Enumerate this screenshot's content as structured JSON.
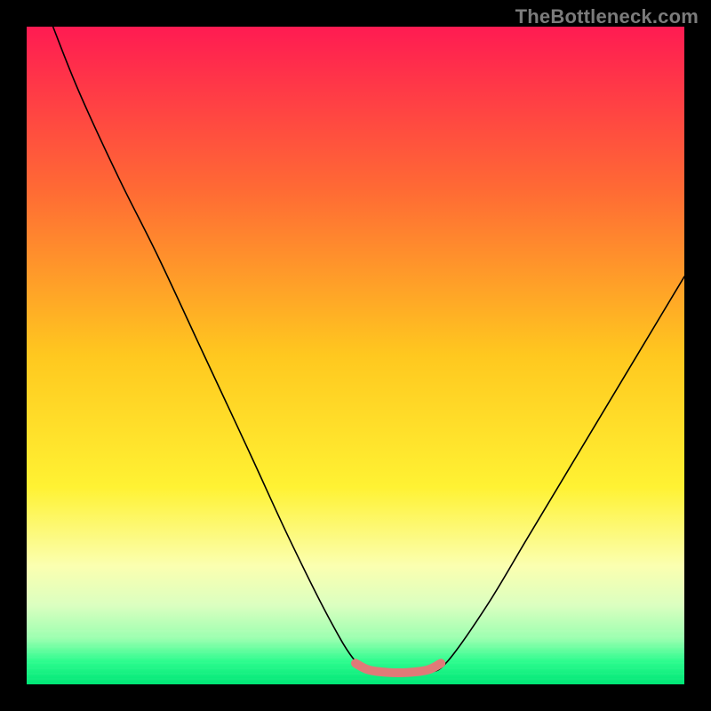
{
  "watermark": "TheBottleneck.com",
  "chart_data": {
    "type": "line",
    "title": "",
    "xlabel": "",
    "ylabel": "",
    "xlim": [
      0,
      100
    ],
    "ylim": [
      0,
      100
    ],
    "grid": false,
    "legend": false,
    "background": {
      "gradient_stops": [
        {
          "pos": 0.0,
          "color": "#ff1b52"
        },
        {
          "pos": 0.25,
          "color": "#ff6b34"
        },
        {
          "pos": 0.5,
          "color": "#ffc81f"
        },
        {
          "pos": 0.7,
          "color": "#fff233"
        },
        {
          "pos": 0.82,
          "color": "#fbffb0"
        },
        {
          "pos": 0.88,
          "color": "#dbffc0"
        },
        {
          "pos": 0.93,
          "color": "#9cffb0"
        },
        {
          "pos": 0.965,
          "color": "#2dfc8e"
        },
        {
          "pos": 1.0,
          "color": "#00e676"
        }
      ]
    },
    "series": [
      {
        "name": "bottleneck-curve",
        "stroke": "#000000",
        "stroke_width": 1.6,
        "points": [
          {
            "x": 4,
            "y": 100
          },
          {
            "x": 8,
            "y": 90
          },
          {
            "x": 14,
            "y": 77
          },
          {
            "x": 20,
            "y": 65
          },
          {
            "x": 27,
            "y": 50
          },
          {
            "x": 34,
            "y": 35
          },
          {
            "x": 40,
            "y": 22
          },
          {
            "x": 46,
            "y": 10
          },
          {
            "x": 50,
            "y": 3.5
          },
          {
            "x": 53,
            "y": 1.8
          },
          {
            "x": 57,
            "y": 1.6
          },
          {
            "x": 61,
            "y": 1.8
          },
          {
            "x": 64,
            "y": 3.5
          },
          {
            "x": 70,
            "y": 12
          },
          {
            "x": 76,
            "y": 22
          },
          {
            "x": 82,
            "y": 32
          },
          {
            "x": 88,
            "y": 42
          },
          {
            "x": 94,
            "y": 52
          },
          {
            "x": 100,
            "y": 62
          }
        ]
      },
      {
        "name": "optimum-highlight",
        "stroke": "#e07a78",
        "stroke_width": 10,
        "points": [
          {
            "x": 50,
            "y": 3.2
          },
          {
            "x": 52,
            "y": 2.2
          },
          {
            "x": 55,
            "y": 1.8
          },
          {
            "x": 58,
            "y": 1.8
          },
          {
            "x": 61,
            "y": 2.2
          },
          {
            "x": 63,
            "y": 3.2
          }
        ]
      }
    ]
  }
}
